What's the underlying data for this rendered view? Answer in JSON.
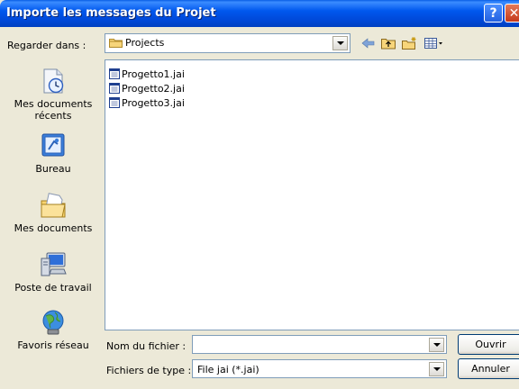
{
  "window": {
    "title": "Importe les messages du Projet"
  },
  "lookin": {
    "label": "Regarder dans :",
    "value": "Projects"
  },
  "places": [
    {
      "label": "Mes documents récents",
      "icon": "recent-documents-icon"
    },
    {
      "label": "Bureau",
      "icon": "desktop-icon"
    },
    {
      "label": "Mes documents",
      "icon": "my-documents-icon"
    },
    {
      "label": "Poste de travail",
      "icon": "my-computer-icon"
    },
    {
      "label": "Favoris réseau",
      "icon": "network-places-icon"
    }
  ],
  "files": [
    {
      "name": "Progetto1.jai"
    },
    {
      "name": "Progetto2.jai"
    },
    {
      "name": "Progetto3.jai"
    }
  ],
  "filename": {
    "label": "Nom du fichier :",
    "value": ""
  },
  "filetype": {
    "label": "Fichiers de type :",
    "value": "File jai (*.jai)"
  },
  "buttons": {
    "open": "Ouvrir",
    "cancel": "Annuler"
  },
  "colors": {
    "titlebar": "#0058EE",
    "dialog_bg": "#ECE9D8",
    "border": "#7F9DB9"
  }
}
